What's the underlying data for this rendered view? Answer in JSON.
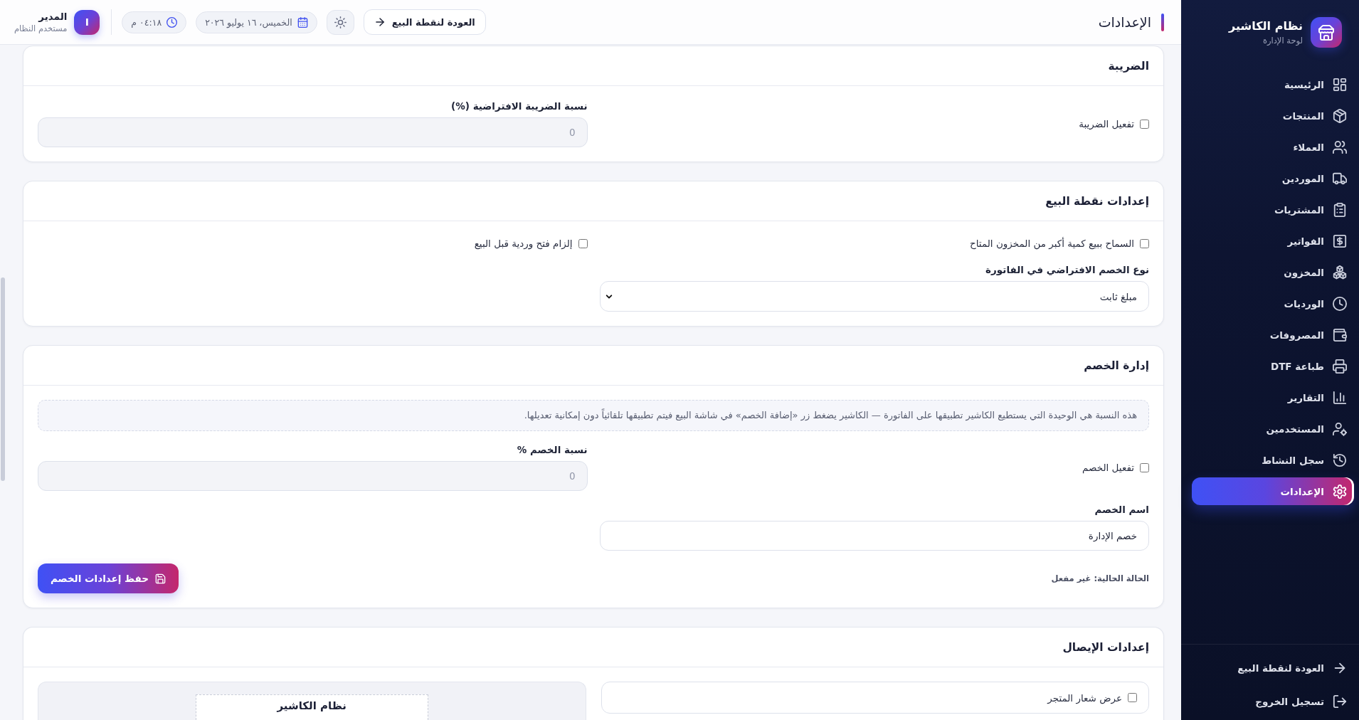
{
  "sidebar": {
    "brand": {
      "title": "نظام الكاشير",
      "subtitle": "لوحة الإدارة"
    },
    "items": [
      {
        "label": "الرئيسية",
        "selected": false
      },
      {
        "label": "المنتجات",
        "selected": false
      },
      {
        "label": "العملاء",
        "selected": false
      },
      {
        "label": "الموردين",
        "selected": false
      },
      {
        "label": "المشتريات",
        "selected": false
      },
      {
        "label": "الفواتير",
        "selected": false
      },
      {
        "label": "المخزون",
        "selected": false
      },
      {
        "label": "الورديات",
        "selected": false
      },
      {
        "label": "المصروفات",
        "selected": false
      },
      {
        "label": "طباعة DTF",
        "selected": false
      },
      {
        "label": "التقارير",
        "selected": false
      },
      {
        "label": "المستخدمين",
        "selected": false
      },
      {
        "label": "سجل النشاط",
        "selected": false
      },
      {
        "label": "الإعدادات",
        "selected": true
      }
    ],
    "footer_items": [
      {
        "label": "العودة لنقطة البيع"
      },
      {
        "label": "تسجيل الخروج"
      }
    ]
  },
  "header": {
    "title": "الإعدادات",
    "back_button": "العودة لنقطة البيع",
    "date": "الخميس، ١٦ يوليو ٢٠٢٦",
    "time": "٠٤:١٨ م",
    "user": {
      "initial": "I",
      "name": "المدير",
      "role": "مستخدم النظام"
    }
  },
  "sections": [
    {
      "title": "الضريبة",
      "fields": [
        {
          "kind": "checkbox",
          "label": "تفعيل الضريبة",
          "checked": false
        },
        {
          "kind": "input",
          "label": "نسبة الضريبة الافتراضية (%)",
          "value": "0",
          "disabled": true
        }
      ]
    },
    {
      "title": "إعدادات نقطة البيع",
      "fields": [
        {
          "kind": "checkbox",
          "label": "السماح ببيع كمية أكبر من المخزون المتاح",
          "checked": false
        },
        {
          "kind": "checkbox",
          "label": "إلزام فتح وردية قبل البيع",
          "checked": false
        },
        {
          "kind": "select",
          "label": "نوع الخصم الافتراضي في الفاتورة",
          "value": "مبلغ ثابت"
        }
      ]
    },
    {
      "title": "إدارة الخصم",
      "fields": [
        {
          "kind": "note",
          "text": "هذه النسبة هي الوحيدة التي يستطيع الكاشير تطبيقها على الفاتورة — الكاشير يضغط زر «إضافة الخصم» في شاشة البيع فيتم تطبيقها تلقائياً دون إمكانية تعديلها."
        },
        {
          "kind": "checkbox",
          "label": "تفعيل الخصم",
          "checked": false
        },
        {
          "kind": "input",
          "label": "نسبة الخصم %",
          "value": "0",
          "disabled": true
        },
        {
          "kind": "input",
          "label": "اسم الخصم",
          "value": "خصم الإدارة",
          "disabled": false
        }
      ],
      "footer": {
        "status": "الحالة الحالية: غير مفعل",
        "button": "حفظ إعدادات الخصم"
      }
    },
    {
      "title": "إعدادات الإيصال",
      "fields": [
        {
          "kind": "option",
          "label": "عرض شعار المتجر",
          "checked": false
        },
        {
          "kind": "preview",
          "store_name": "نظام الكاشير"
        }
      ]
    }
  ]
}
